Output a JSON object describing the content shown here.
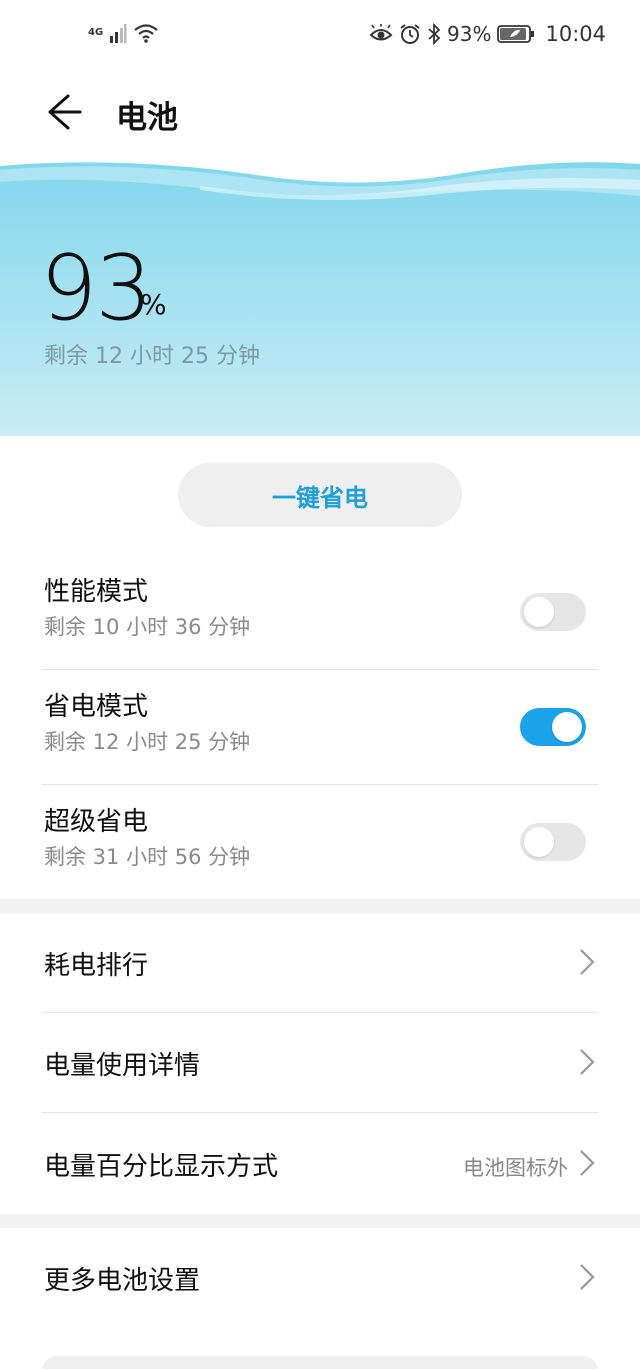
{
  "status_bar": {
    "network": "4G",
    "battery_percent": "93%",
    "battery_level": 0.93,
    "time": "10:04",
    "icons": [
      "eye-icon",
      "alarm-icon",
      "bluetooth-icon",
      "battery-icon",
      "signal-icon",
      "wifi-icon"
    ]
  },
  "header": {
    "title": "电池"
  },
  "battery": {
    "percent": "93",
    "percent_sign": "%",
    "remaining": "剩余 12 小时 25 分钟"
  },
  "one_key_save": {
    "label": "一键省电"
  },
  "modes": [
    {
      "title": "性能模式",
      "remaining": "剩余 10 小时 36 分钟",
      "enabled": false
    },
    {
      "title": "省电模式",
      "remaining": "剩余 12 小时 25 分钟",
      "enabled": true
    },
    {
      "title": "超级省电",
      "remaining": "剩余 31 小时 56 分钟",
      "enabled": false
    }
  ],
  "menu": [
    {
      "label": "耗电排行",
      "value": ""
    },
    {
      "label": "电量使用详情",
      "value": ""
    },
    {
      "label": "电量百分比显示方式",
      "value": "电池图标外"
    }
  ],
  "more": {
    "label": "更多电池设置"
  },
  "colors": {
    "accent": "#1aa3e8",
    "hero_top": "#7fd6ec",
    "hero_bottom": "#c8ecf6",
    "button_text": "#1e9fd8"
  }
}
